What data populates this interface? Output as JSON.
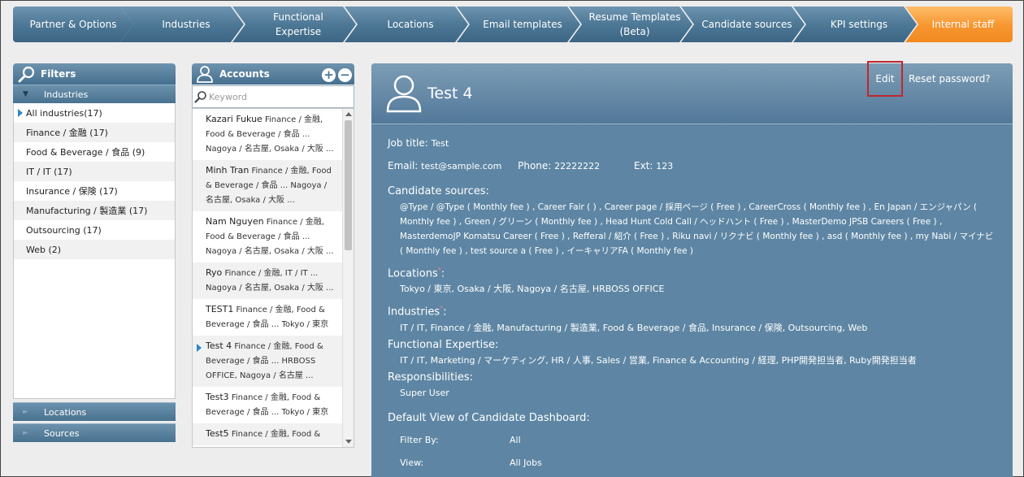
{
  "nav": {
    "steps": [
      {
        "label": "Partner & Options"
      },
      {
        "label": "Industries"
      },
      {
        "label": "Functional\nExpertise"
      },
      {
        "label": "Locations"
      },
      {
        "label": "Email templates"
      },
      {
        "label": "Resume Templates\n(Beta)"
      },
      {
        "label": "Candidate sources"
      },
      {
        "label": "KPI settings"
      },
      {
        "label": "Internal staff"
      }
    ],
    "active_color": "#f7952f"
  },
  "filters": {
    "title": "Filters",
    "industries_label": "Industries",
    "items": [
      {
        "label": "All industries(17)"
      },
      {
        "label": "Finance / 金融 (17)"
      },
      {
        "label": "Food & Beverage / 食品 (9)"
      },
      {
        "label": "IT / IT (17)"
      },
      {
        "label": "Insurance / 保険 (17)"
      },
      {
        "label": "Manufacturing / 製造業 (17)"
      },
      {
        "label": "Outsourcing (17)"
      },
      {
        "label": "Web (2)"
      }
    ],
    "locations_label": "Locations",
    "sources_label": "Sources"
  },
  "accounts": {
    "title": "Accounts",
    "add_label": "+",
    "remove_label": "−",
    "search_placeholder": "Keyword",
    "items": [
      {
        "name": "Kazari Fukue",
        "detail": " Finance / 金融, Food & Beverage / 食品 ... Nagoya / 名古屋, Osaka / 大阪 ..."
      },
      {
        "name": "Minh Tran",
        "detail": " Finance / 金融, Food & Beverage / 食品 ... Nagoya / 名古屋, Osaka / 大阪 ..."
      },
      {
        "name": "Nam Nguyen",
        "detail": " Finance / 金融, Food & Beverage / 食品 ... Nagoya / 名古屋, Osaka / 大阪 ..."
      },
      {
        "name": "Ryo",
        "detail": " Finance / 金融, IT / IT ... Nagoya / 名古屋, Osaka / 大阪 ..."
      },
      {
        "name": "TEST1",
        "detail": " Finance / 金融, Food & Beverage / 食品 ... Tokyo / 東京"
      },
      {
        "name": "Test 4",
        "detail": " Finance / 金融, Food & Beverage / 食品 ... HRBOSS OFFICE, Nagoya / 名古屋 ..."
      },
      {
        "name": "Test3",
        "detail": " Finance / 金融, Food & Beverage / 食品 ... Tokyo / 東京"
      },
      {
        "name": "Test5",
        "detail": " Finance / 金融, Food &"
      }
    ]
  },
  "detail": {
    "name": "Test 4",
    "edit_label": "Edit",
    "reset_label": "Reset password?",
    "job_title_label": "Job title:",
    "job_title": "Test",
    "email_label": "Email:",
    "email": "test@sample.com",
    "phone_label": "Phone:",
    "phone": "22222222",
    "ext_label": "Ext:",
    "ext": "123",
    "candidate_sources_label": "Candidate sources:",
    "candidate_sources": "@Type / @Type ( Monthly fee ) , Career Fair ( ) , Career page / 採用ページ ( Free ) , CareerCross ( Monthly fee ) , En Japan / エンジャパン ( Monthly fee ) , Green / グリーン ( Monthly fee ) , Head Hunt Cold Call / ヘッドハント ( Free ) , MasterDemo JPSB Careers ( Free ) , MasterdemoJP Komatsu Career ( Free ) , Refferal / 紹介 ( Free ) , Riku navi / リクナビ ( Monthly fee ) , asd ( Monthly fee ) , my Nabi / マイナビ ( Monthly fee ) , test source a ( Free ) , イーキャリアFA ( Monthly fee )",
    "locations_label": "Locations",
    "required_mark": "*",
    "locations": "Tokyo / 東京, Osaka / 大阪, Nagoya / 名古屋, HRBOSS OFFICE",
    "industries_label": "Industries",
    "industries": "IT / IT, Finance / 金融, Manufacturing / 製造業, Food & Beverage / 食品, Insurance / 保険, Outsourcing, Web",
    "functional_label": "Functional Expertise:",
    "functional": "IT / IT, Marketing / マーケティング, HR / 人事, Sales / 営業, Finance & Accounting / 経理, PHP開発担当者, Ruby開発担当者",
    "responsibilities_label": "Responsibilities:",
    "responsibilities": "Super User",
    "default_view_label": "Default View of Candidate Dashboard:",
    "filter_by_label": "Filter By:",
    "filter_by": "All",
    "view_label": "View:",
    "view": "All Jobs"
  }
}
